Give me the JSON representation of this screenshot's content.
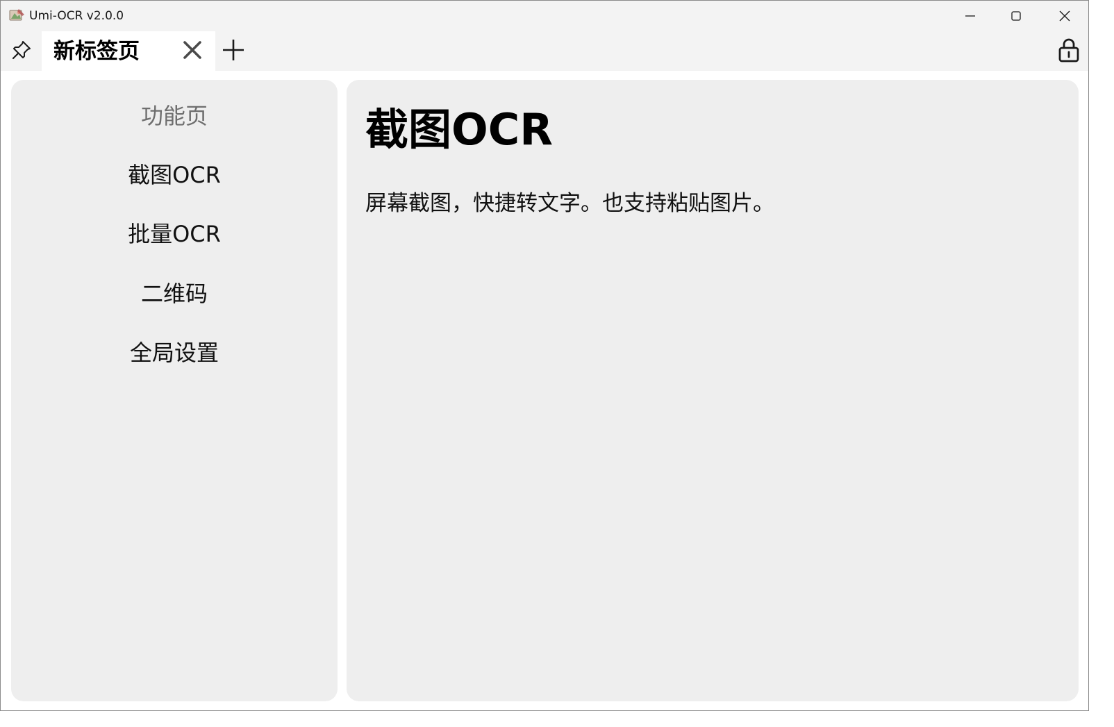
{
  "window": {
    "title": "Umi-OCR v2.0.0",
    "icon": "umi-ocr-app-icon"
  },
  "window_controls": {
    "minimize_icon": "minimize-icon",
    "maximize_icon": "maximize-icon",
    "close_icon": "close-icon"
  },
  "tabbar": {
    "pin_icon": "pin-icon",
    "tabs": [
      {
        "label": "新标签页",
        "close_icon": "close-tab-icon",
        "active": true
      }
    ],
    "add_tab_icon": "plus-icon",
    "lock_icon": "lock-icon"
  },
  "sidebar": {
    "heading": "功能页",
    "items": [
      {
        "label": "截图OCR"
      },
      {
        "label": "批量OCR"
      },
      {
        "label": "二维码"
      },
      {
        "label": "全局设置"
      }
    ]
  },
  "main": {
    "title": "截图OCR",
    "description": "屏幕截图，快捷转文字。也支持粘贴图片。"
  },
  "colors": {
    "titlebar_bg": "#f3f3f3",
    "active_tab_bg": "#ffffff",
    "panel_bg": "#eeeeee",
    "heading_gray": "#6e6e6e",
    "text": "#111111"
  }
}
